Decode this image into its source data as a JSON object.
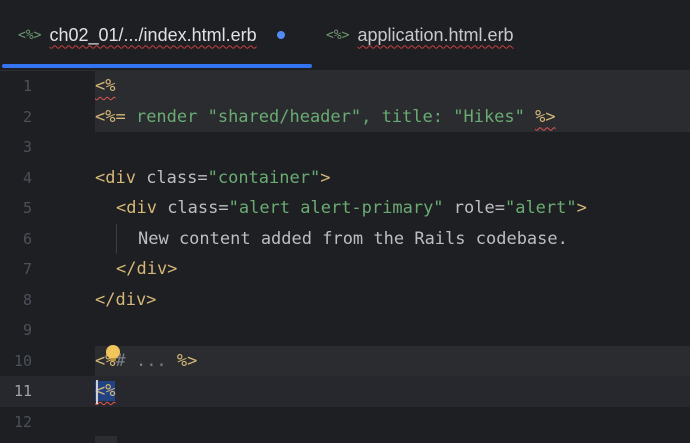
{
  "tabs": [
    {
      "icon": "<%>",
      "label": "ch02_01/.../index.html.erb",
      "modified": true
    },
    {
      "icon": "<%>",
      "label": "application.html.erb",
      "modified": false
    }
  ],
  "lines": [
    {
      "num": "1"
    },
    {
      "num": "2"
    },
    {
      "num": "3"
    },
    {
      "num": "4"
    },
    {
      "num": "5"
    },
    {
      "num": "6"
    },
    {
      "num": "7"
    },
    {
      "num": "8"
    },
    {
      "num": "9"
    },
    {
      "num": "10"
    },
    {
      "num": "11"
    },
    {
      "num": "12"
    }
  ],
  "code": {
    "l1": {
      "open": "<%"
    },
    "l2": {
      "open": "<%=",
      "body": " render \"shared/header\", title: \"Hikes\" ",
      "close": "%>"
    },
    "l4": {
      "open": "<div",
      "attr": " class=",
      "val": "\"container\"",
      "close": ">"
    },
    "l5": {
      "open": "<div",
      "attr1": " class=",
      "val1": "\"alert alert-primary\"",
      "attr2": " role=",
      "val2": "\"alert\"",
      "close": ">"
    },
    "l6": {
      "text": "New content added from the Rails codebase."
    },
    "l7": {
      "tag": "</div>"
    },
    "l8": {
      "tag": "</div>"
    },
    "l10": {
      "open": "<%",
      "comment": "# ... ",
      "close": "%>"
    },
    "l11": {
      "open": "<%"
    }
  },
  "current_line": 11,
  "colors": {
    "accent": "#3574f0",
    "selection": "#214283",
    "bulb": "#f2c55c"
  }
}
